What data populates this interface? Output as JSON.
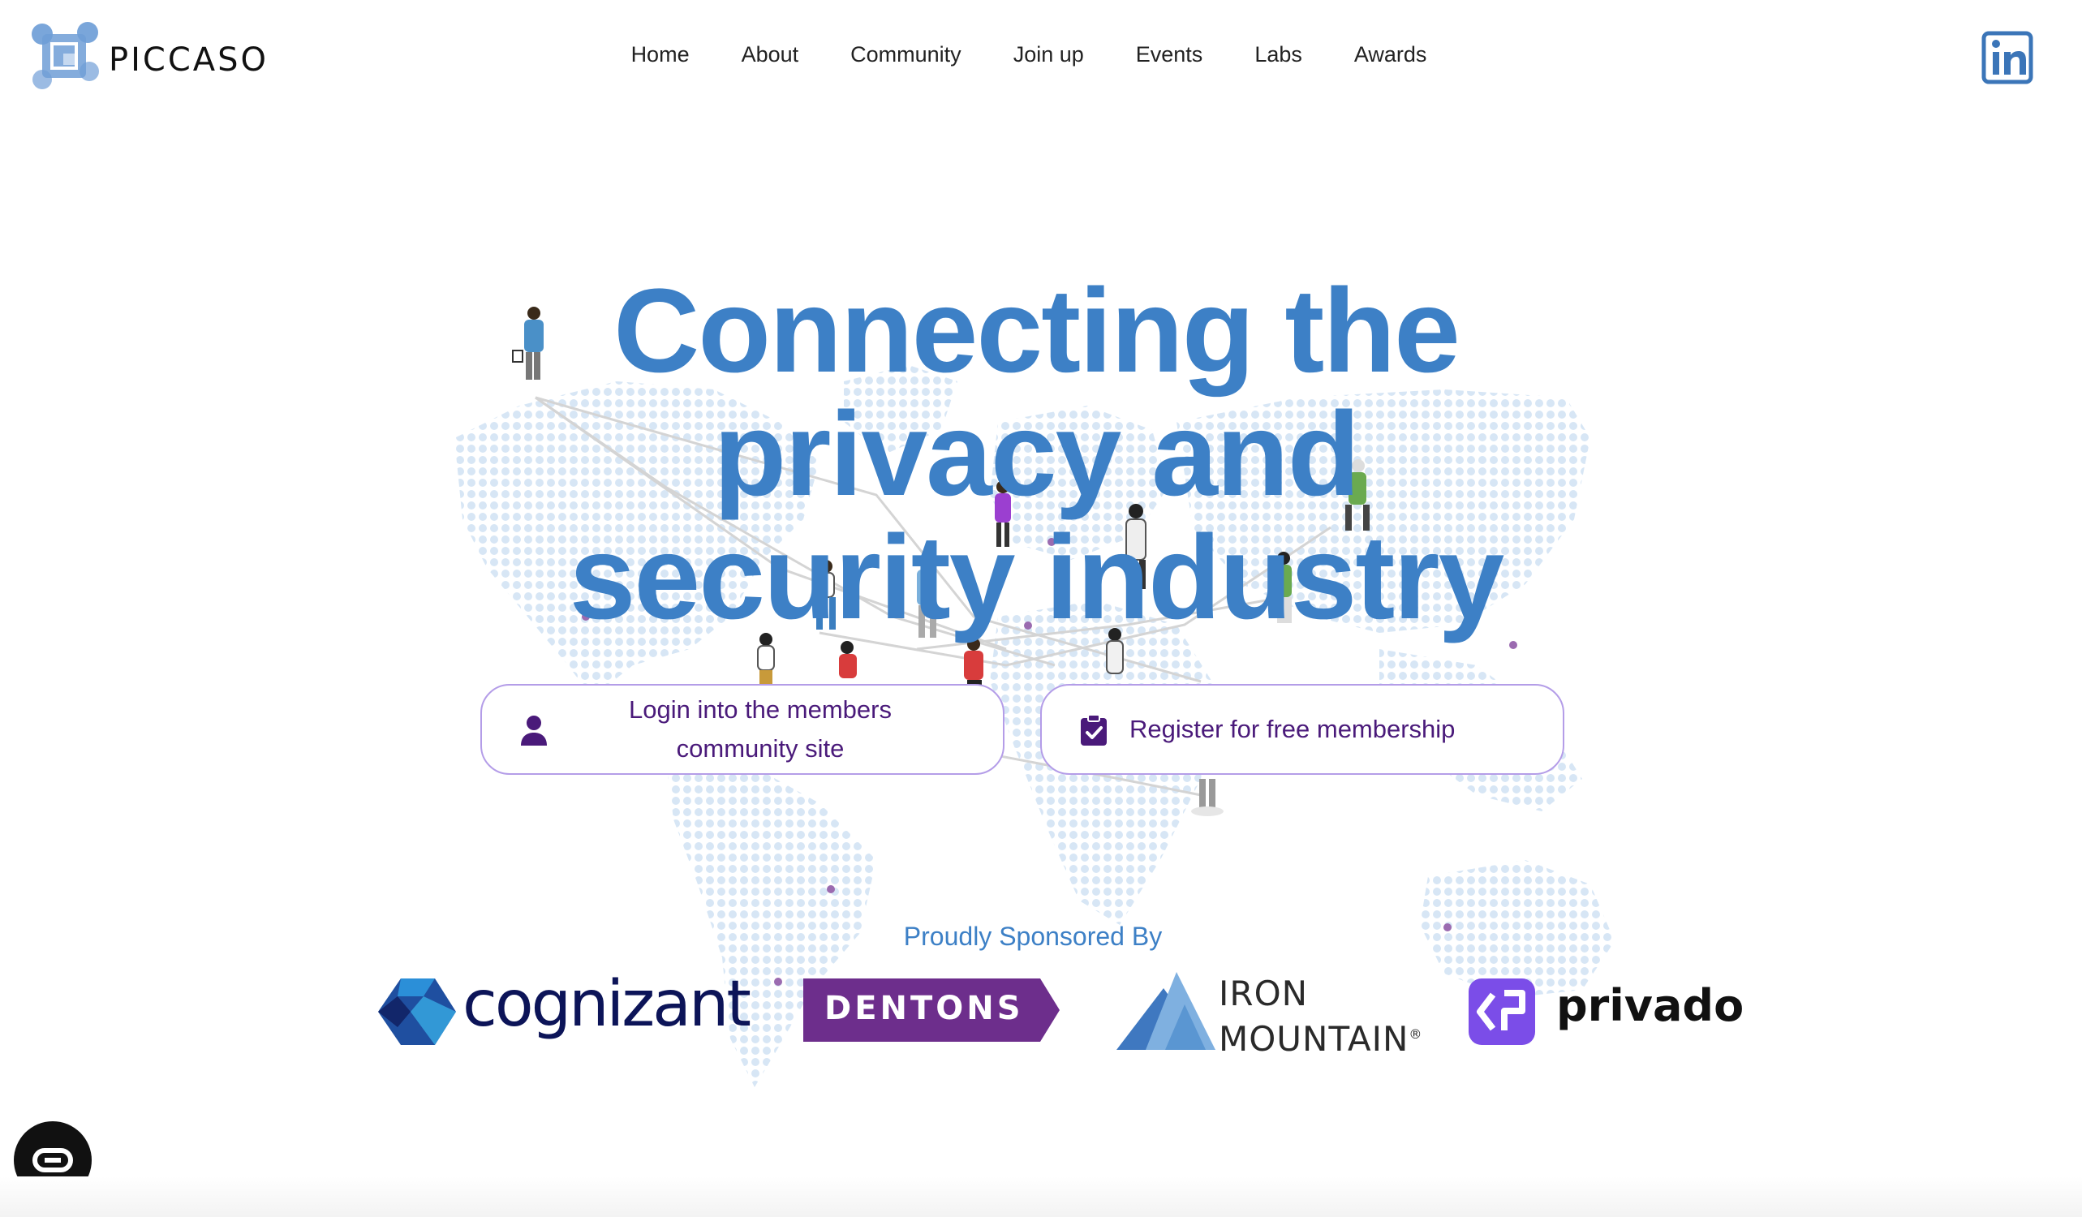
{
  "brand": {
    "name": "PICCASO",
    "accent": "#3d80c6",
    "button_text_color": "#4a1a7a"
  },
  "nav": {
    "items": [
      "Home",
      "About",
      "Community",
      "Join up",
      "Events",
      "Labs",
      "Awards"
    ]
  },
  "hero": {
    "headline_line1": "Connecting the",
    "headline_line2": "privacy and",
    "headline_line3": "security industry"
  },
  "actions": {
    "login_line1": "Login into the members",
    "login_line2": "community site",
    "register": "Register for free membership"
  },
  "sponsors": {
    "heading": "Proudly Sponsored By",
    "cognizant": "cognizant",
    "dentons": "DENTONS",
    "iron_mountain_line1": "IRON",
    "iron_mountain_line2": "MOUNTAIN",
    "iron_mountain_mark": "®",
    "privado": "privado"
  },
  "icons": {
    "linkedin": "linkedin-icon",
    "login": "person-icon",
    "register": "clipboard-check-icon",
    "chat": "chat-icon"
  }
}
